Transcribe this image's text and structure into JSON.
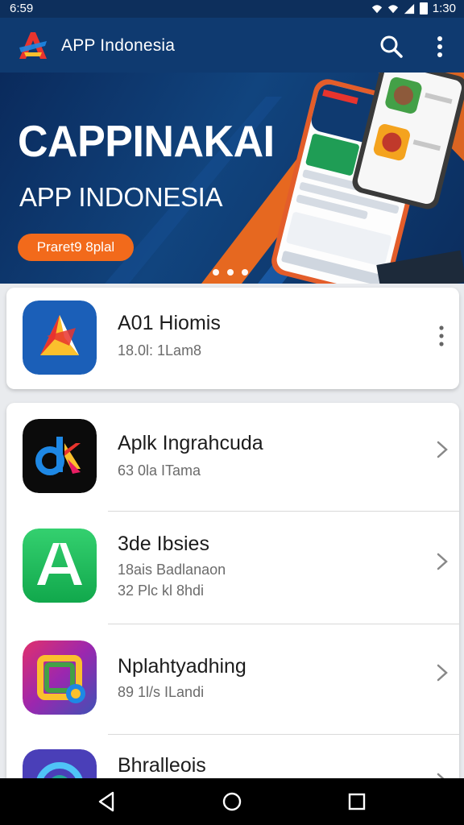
{
  "status_bar": {
    "time": "6:59",
    "clock": "1:30"
  },
  "app_bar": {
    "title": "APP Indonesia",
    "logo_letter": "A"
  },
  "banner": {
    "title": "CAPPINAKAI",
    "subtitle": "APP INDONESIA",
    "button_label": "Praret9 8plal"
  },
  "featured": {
    "name": "A01 Hiomis",
    "meta": "18.0l: 1Lam8"
  },
  "apps": [
    {
      "name": "Aplk Ingrahcuda",
      "meta": [
        "63 0la ITama"
      ]
    },
    {
      "name": "3de Ibsies",
      "meta": [
        "18ais Badlanaon",
        "32 Plc kl 8hdi"
      ]
    },
    {
      "name": "Nplahtyadhing",
      "meta": [
        "89 1l/s ILandi"
      ]
    },
    {
      "name": "Bhralleois",
      "meta": []
    }
  ],
  "colors": {
    "app_bar": "#0f3a70",
    "accent": "#f26a1b",
    "status_bar": "#0d2f5c"
  },
  "icons": [
    "search-icon",
    "more-vert-icon",
    "chevron-right-icon",
    "back-icon",
    "home-icon",
    "recents-icon",
    "wifi-icon",
    "signal-icon",
    "battery-icon"
  ]
}
